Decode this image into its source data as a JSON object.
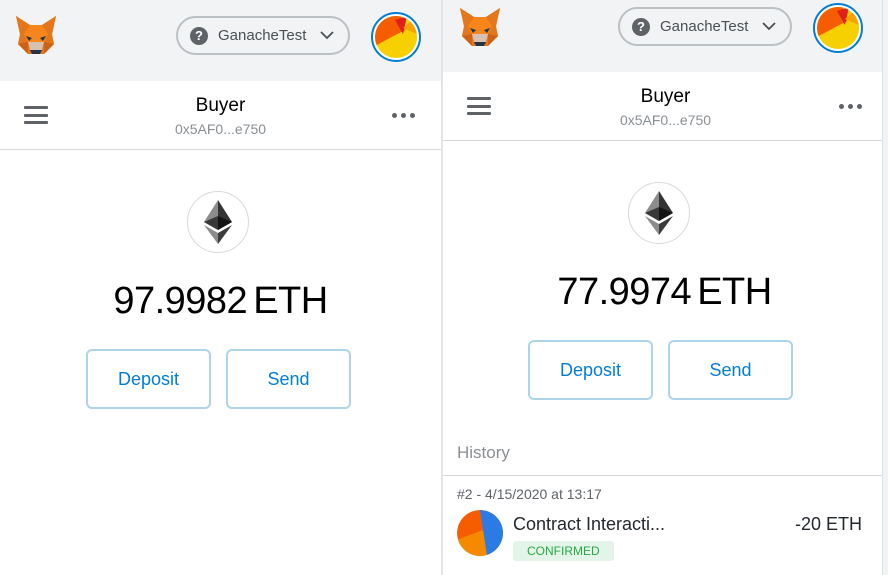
{
  "left_panel": {
    "network": {
      "label": "GanacheTest"
    },
    "account": {
      "name": "Buyer",
      "address": "0x5AF0...e750"
    },
    "balance": {
      "amount": "97.9982",
      "currency": "ETH"
    },
    "buttons": {
      "deposit": "Deposit",
      "send": "Send"
    }
  },
  "right_panel": {
    "network": {
      "label": "GanacheTest"
    },
    "account": {
      "name": "Buyer",
      "address": "0x5AF0...e750"
    },
    "balance": {
      "amount": "77.9974",
      "currency": "ETH"
    },
    "buttons": {
      "deposit": "Deposit",
      "send": "Send"
    },
    "history": {
      "title": "History",
      "transactions": [
        {
          "meta": "#2 - 4/15/2020 at 13:17",
          "title": "Contract Interacti...",
          "status": "CONFIRMED",
          "amount": "-20 ETH"
        }
      ]
    }
  },
  "colors": {
    "accent": "#037dd6",
    "button_border": "#aed4ea",
    "topbar": "#f2f3f4",
    "confirmed_text": "#28a745",
    "confirmed_bg": "#e3f5e8"
  },
  "icons": [
    "metamask-fox-icon",
    "question-icon",
    "chevron-down-icon",
    "account-avatar-icon",
    "hamburger-icon",
    "more-dots-icon",
    "ethereum-icon"
  ]
}
